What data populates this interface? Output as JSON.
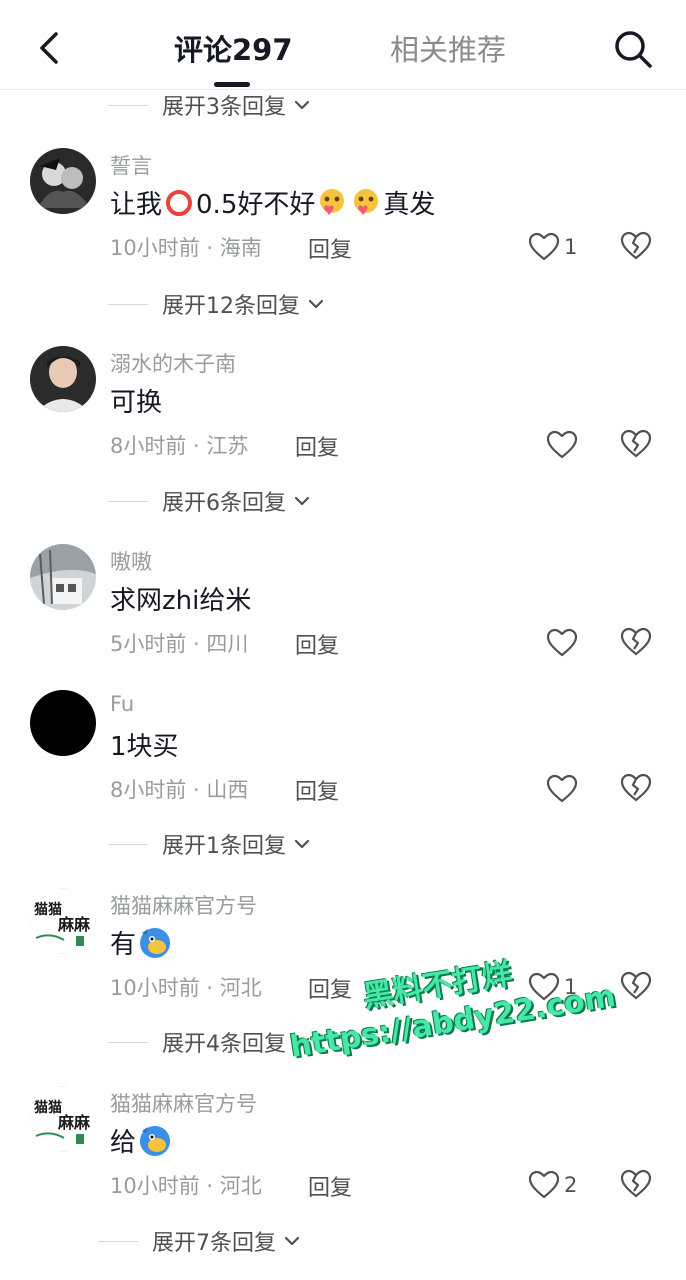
{
  "header": {
    "tab_comments": "评论297",
    "tab_related": "相关推荐"
  },
  "expand_top": "展开3条回复",
  "comments": [
    {
      "username": "誓言",
      "content_prefix": "让我",
      "content_suffix": "0.5好不好",
      "content_end": "真发",
      "meta": "10小时前 · 海南",
      "reply": "回复",
      "likes": "1",
      "expand": "展开12条回复"
    },
    {
      "username": "溺水的木子南",
      "content": "可换",
      "meta": "8小时前 · 江苏",
      "reply": "回复",
      "likes": "",
      "expand": "展开6条回复"
    },
    {
      "username": "嗷嗷",
      "content": "求网zhi给米",
      "meta": "5小时前 · 四川",
      "reply": "回复",
      "likes": ""
    },
    {
      "username": "Fu",
      "content": "1块买",
      "meta": "8小时前 · 山西",
      "reply": "回复",
      "likes": "",
      "expand": "展开1条回复"
    },
    {
      "username": "猫猫麻麻官方号",
      "content": "有",
      "meta": "10小时前 · 河北",
      "reply": "回复",
      "likes": "1",
      "expand": "展开4条回复"
    },
    {
      "username": "猫猫麻麻官方号",
      "content": "给",
      "meta": "10小时前 · 河北",
      "reply": "回复",
      "likes": "2",
      "expand": "展开7条回复"
    }
  ],
  "avatar_text": {
    "line1": "猫猫",
    "line2": "麻麻"
  },
  "watermark": {
    "line1": "黑料不打烊",
    "line2": "https://abdy22.com"
  },
  "colors": {
    "text_primary": "#161823",
    "text_secondary": "#9a9ba0",
    "watermark": "#46e8a8"
  }
}
